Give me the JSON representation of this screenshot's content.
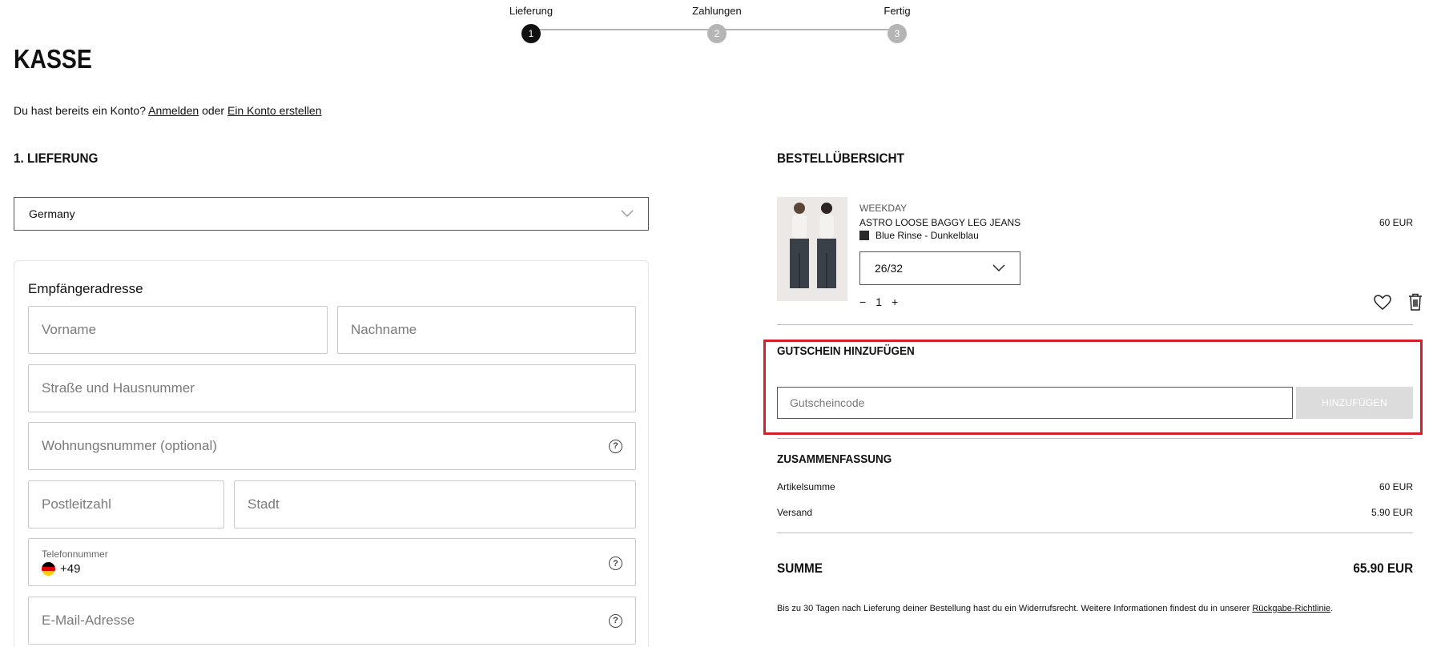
{
  "stepper": {
    "steps": [
      {
        "label": "Lieferung",
        "number": "1",
        "state": "active"
      },
      {
        "label": "Zahlungen",
        "number": "2",
        "state": "inactive"
      },
      {
        "label": "Fertig",
        "number": "3",
        "state": "inactive"
      }
    ]
  },
  "page": {
    "title": "KASSE",
    "account_prompt": "Du hast bereits ein Konto?",
    "login_link": "Anmelden",
    "or_text": "oder",
    "register_link": "Ein Konto erstellen"
  },
  "delivery": {
    "heading": "1. LIEFERUNG",
    "country_value": "Germany",
    "address_card": {
      "title": "Empfängeradresse",
      "first_name_placeholder": "Vorname",
      "last_name_placeholder": "Nachname",
      "street_placeholder": "Straße und Hausnummer",
      "apartment_placeholder": "Wohnungsnummer (optional)",
      "postal_code_placeholder": "Postleitzahl",
      "city_placeholder": "Stadt",
      "phone_label": "Telefonnummer",
      "phone_prefix": "+49",
      "email_placeholder": "E-Mail-Adresse"
    }
  },
  "order_summary": {
    "heading": "BESTELLÜBERSICHT",
    "item": {
      "brand": "WEEKDAY",
      "name": "ASTRO LOOSE BAGGY LEG JEANS",
      "price": "60 EUR",
      "color": "Blue Rinse - Dunkelblau",
      "swatch_color": "#2b2b2b",
      "size": "26/32",
      "quantity": "1",
      "minus": "−",
      "plus": "+"
    },
    "coupon": {
      "heading": "GUTSCHEIN HINZUFÜGEN",
      "placeholder": "Gutscheincode",
      "button_label": "HINZUFÜGEN",
      "highlight_color": "#d3202b"
    },
    "totals": {
      "heading": "ZUSAMMENFASSUNG",
      "subtotal_label": "Artikelsumme",
      "subtotal_value": "60 EUR",
      "shipping_label": "Versand",
      "shipping_value": "5.90 EUR",
      "total_label": "SUMME",
      "total_value": "65.90 EUR"
    },
    "return_note": "Bis zu 30 Tagen nach Lieferung deiner Bestellung hast du ein Widerrufsrecht. Weitere Informationen findest du in unserer",
    "return_link": "Rückgabe-Richtlinie",
    "return_suffix": "."
  }
}
